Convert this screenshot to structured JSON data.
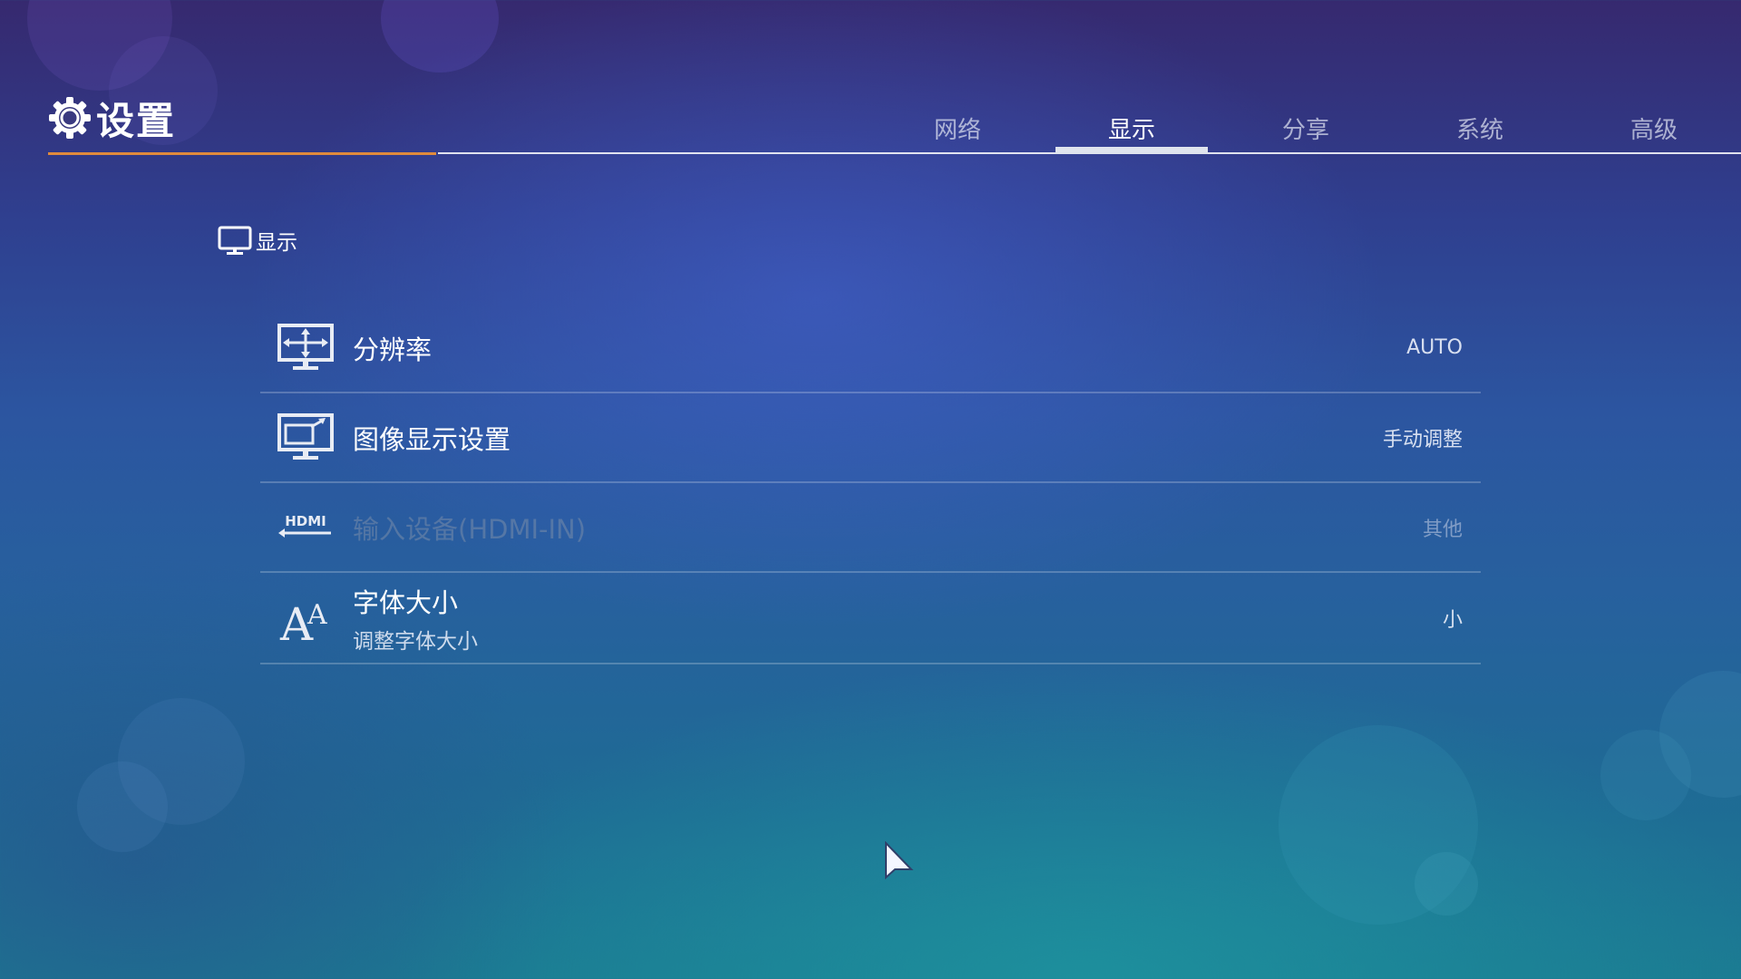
{
  "header": {
    "title": "设置",
    "icon": "gear-icon"
  },
  "tabs": [
    {
      "label": "网络",
      "active": false
    },
    {
      "label": "显示",
      "active": true
    },
    {
      "label": "分享",
      "active": false
    },
    {
      "label": "系统",
      "active": false
    },
    {
      "label": "高级",
      "active": false
    }
  ],
  "section": {
    "title": "显示",
    "icon": "monitor-icon"
  },
  "items": [
    {
      "label": "分辨率",
      "value": "AUTO",
      "icon": "resolution-icon"
    },
    {
      "label": "图像显示设置",
      "value": "手动调整",
      "icon": "display-adjust-icon"
    },
    {
      "label": "输入设备(HDMI-IN)",
      "value": "其他",
      "icon": "hdmi-icon",
      "disabled": true
    },
    {
      "label": "字体大小",
      "sublabel": "调整字体大小",
      "value": "小",
      "icon": "font-size-icon"
    }
  ],
  "colors": {
    "accent_underline": "#e08a3c",
    "tab_indicator": "#dfe4ee"
  }
}
